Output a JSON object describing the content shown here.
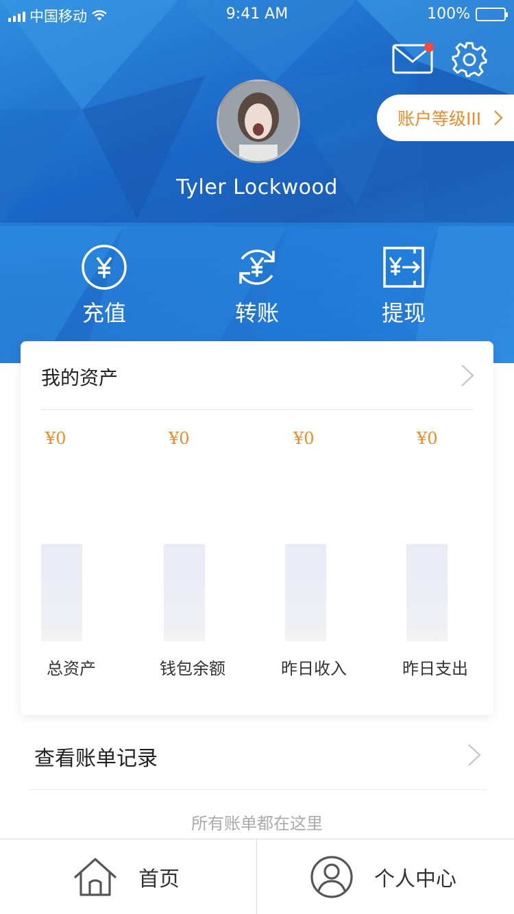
{
  "status_bar": {
    "carrier": "中国移动",
    "time": "9:41 AM",
    "battery": "100%"
  },
  "header": {
    "level_label": "账户等级III",
    "username": "Tyler Lockwood",
    "mail_has_unread": true,
    "actions": [
      {
        "label": "充值",
        "icon": "yen-circle-icon"
      },
      {
        "label": "转账",
        "icon": "yen-refresh-icon"
      },
      {
        "label": "提现",
        "icon": "yen-withdraw-icon"
      }
    ]
  },
  "assets": {
    "title": "我的资产",
    "items": [
      {
        "amount": "¥0",
        "label": "总资产"
      },
      {
        "amount": "¥0",
        "label": "钱包余额"
      },
      {
        "amount": "¥0",
        "label": "昨日收入"
      },
      {
        "amount": "¥0",
        "label": "昨日支出"
      }
    ]
  },
  "bills": {
    "title": "查看账单记录",
    "subtitle": "所有账单都在这里"
  },
  "tabbar": {
    "home_label": "首页",
    "profile_label": "个人中心"
  },
  "colors": {
    "accent_orange": "#f08a24",
    "header_blue": "#1a66c6",
    "notification_red": "#f24a3e"
  }
}
